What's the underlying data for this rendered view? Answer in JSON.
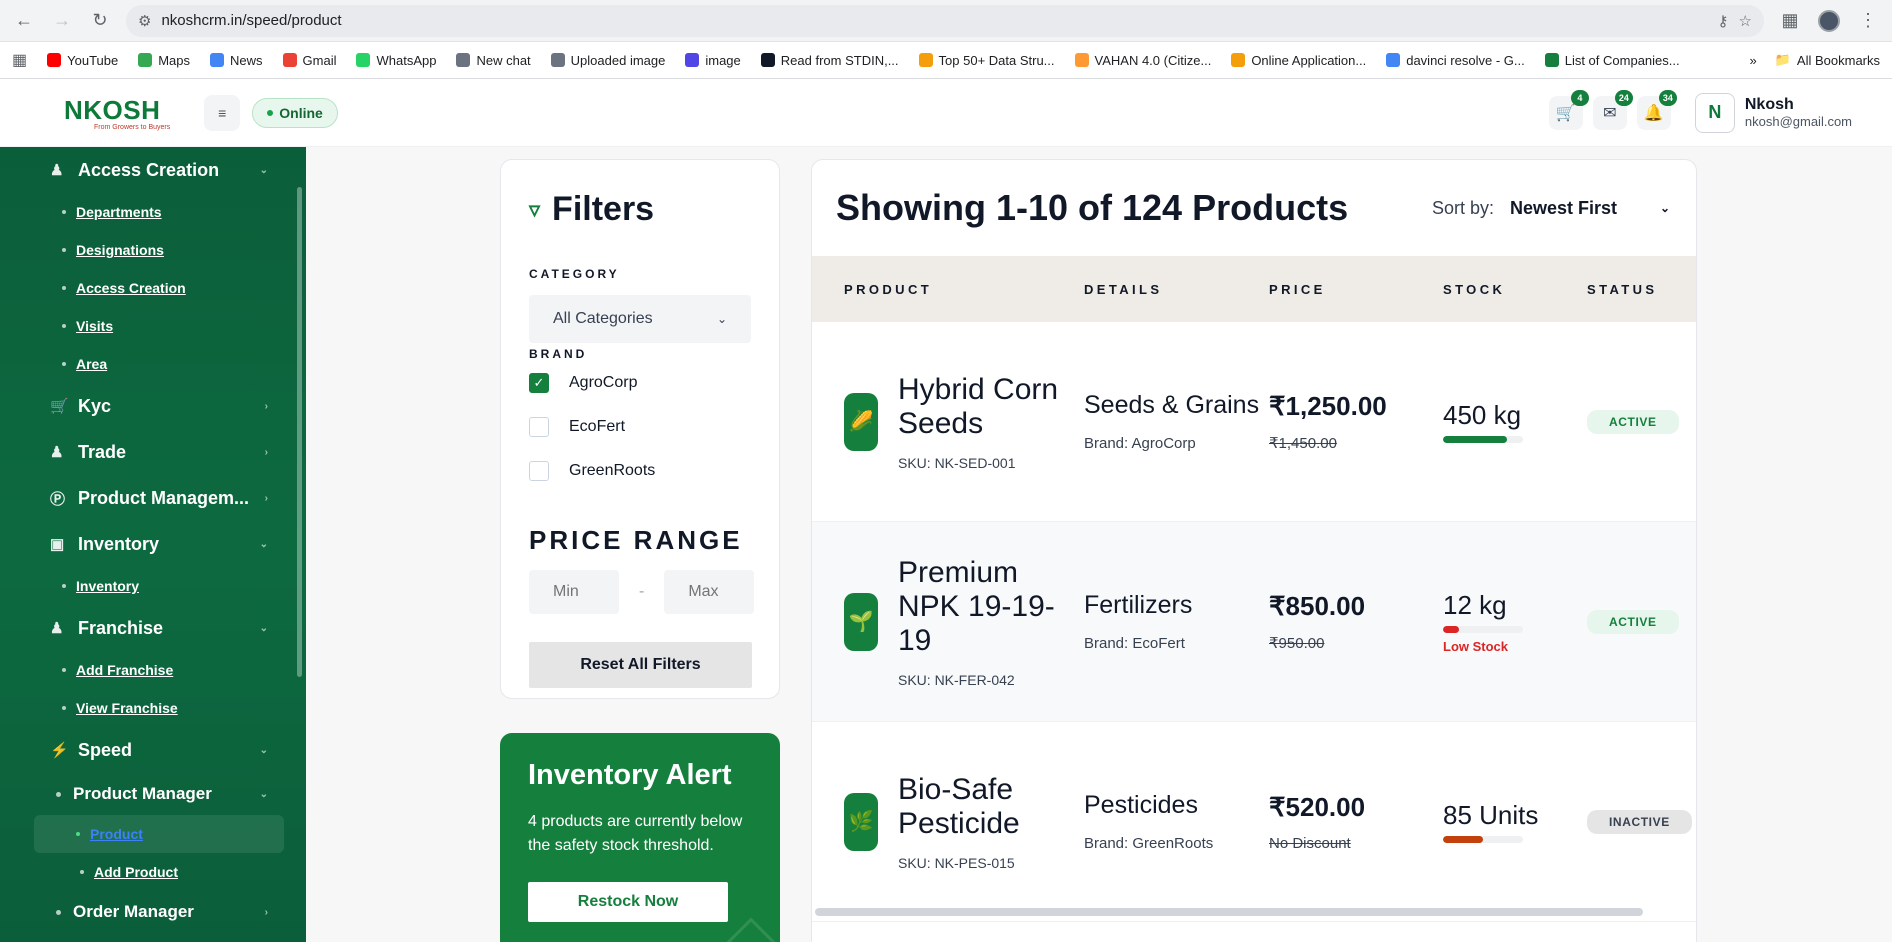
{
  "browser": {
    "url": "nkoshcrm.in/speed/product",
    "bookmarks": [
      "YouTube",
      "Maps",
      "News",
      "Gmail",
      "WhatsApp",
      "New chat",
      "Uploaded image",
      "image",
      "Read from STDIN,...",
      "Top 50+ Data Stru...",
      "VAHAN 4.0 (Citize...",
      "Online Application...",
      "davinci resolve - G...",
      "List of Companies..."
    ],
    "bookmark_colors": [
      "#ff0000",
      "#34a853",
      "#4285f4",
      "#ea4335",
      "#25d366",
      "#6b7280",
      "#6b7280",
      "#4f46e5",
      "#111827",
      "#f59e0b",
      "#ff9933",
      "#f59e0b",
      "#4285f4",
      "#15803d"
    ],
    "all_bookmarks": "All Bookmarks",
    "more": "»"
  },
  "header": {
    "logo": "NKOSH",
    "logo_sub": "From Growers to Buyers",
    "status": "Online",
    "cart_count": "4",
    "mail_count": "24",
    "notif_count": "34",
    "user_initials": "N",
    "user_name": "Nkosh",
    "user_email": "nkosh@gmail.com"
  },
  "sidebar": {
    "access_creation": "Access Creation",
    "access_items": [
      "Departments",
      "Designations",
      "Access Creation",
      "Visits",
      "Area"
    ],
    "kyc": "Kyc",
    "trade": "Trade",
    "product_management": "Product Managem...",
    "inventory": "Inventory",
    "inventory_items": [
      "Inventory"
    ],
    "franchise": "Franchise",
    "franchise_items": [
      "Add Franchise",
      "View Franchise"
    ],
    "speed": "Speed",
    "product_manager": "Product Manager",
    "product_manager_items": [
      "Product",
      "Add Product"
    ],
    "order_manager": "Order Manager"
  },
  "filters": {
    "title": "Filters",
    "category_label": "CATEGORY",
    "category_value": "All Categories",
    "brand_label": "BRAND",
    "brands": [
      {
        "label": "AgroCorp",
        "checked": true
      },
      {
        "label": "EcoFert",
        "checked": false
      },
      {
        "label": "GreenRoots",
        "checked": false
      }
    ],
    "price_label": "PRICE RANGE",
    "min_placeholder": "Min",
    "max_placeholder": "Max",
    "range_sep": "-",
    "reset_label": "Reset All Filters"
  },
  "alert": {
    "title": "Inventory Alert",
    "text": "4 products are currently below the safety stock threshold.",
    "button": "Restock Now"
  },
  "products": {
    "title": "Showing 1-10 of 124 Products",
    "sort_label": "Sort by:",
    "sort_value": "Newest First",
    "columns": [
      "PRODUCT",
      "DETAILS",
      "PRICE",
      "STOCK",
      "STATUS"
    ],
    "rows": [
      {
        "icon": "🌽",
        "name": "Hybrid Corn Seeds",
        "sku": "SKU: NK-SED-001",
        "category": "Seeds & Grains",
        "brand": "Brand: AgroCorp",
        "price": "₹1,250.00",
        "old_price": "₹1,450.00",
        "stock": "450 kg",
        "stock_level": 0.8,
        "stock_color": "#15803d",
        "stock_note": "",
        "status": "ACTIVE",
        "status_type": "active"
      },
      {
        "icon": "🌱",
        "name": "Premium NPK 19-19-19",
        "sku": "SKU: NK-FER-042",
        "category": "Fertilizers",
        "brand": "Brand: EcoFert",
        "price": "₹850.00",
        "old_price": "₹950.00",
        "stock": "12 kg",
        "stock_level": 0.2,
        "stock_color": "#dc2626",
        "stock_note": "Low Stock",
        "status": "ACTIVE",
        "status_type": "active"
      },
      {
        "icon": "🌿",
        "name": "Bio-Safe Pesticide",
        "sku": "SKU: NK-PES-015",
        "category": "Pesticides",
        "brand": "Brand: GreenRoots",
        "price": "₹520.00",
        "old_price": "No Discount",
        "stock": "85 Units",
        "stock_level": 0.5,
        "stock_color": "#c2410c",
        "stock_note": "",
        "status": "INACTIVE",
        "status_type": "inactive"
      }
    ]
  }
}
